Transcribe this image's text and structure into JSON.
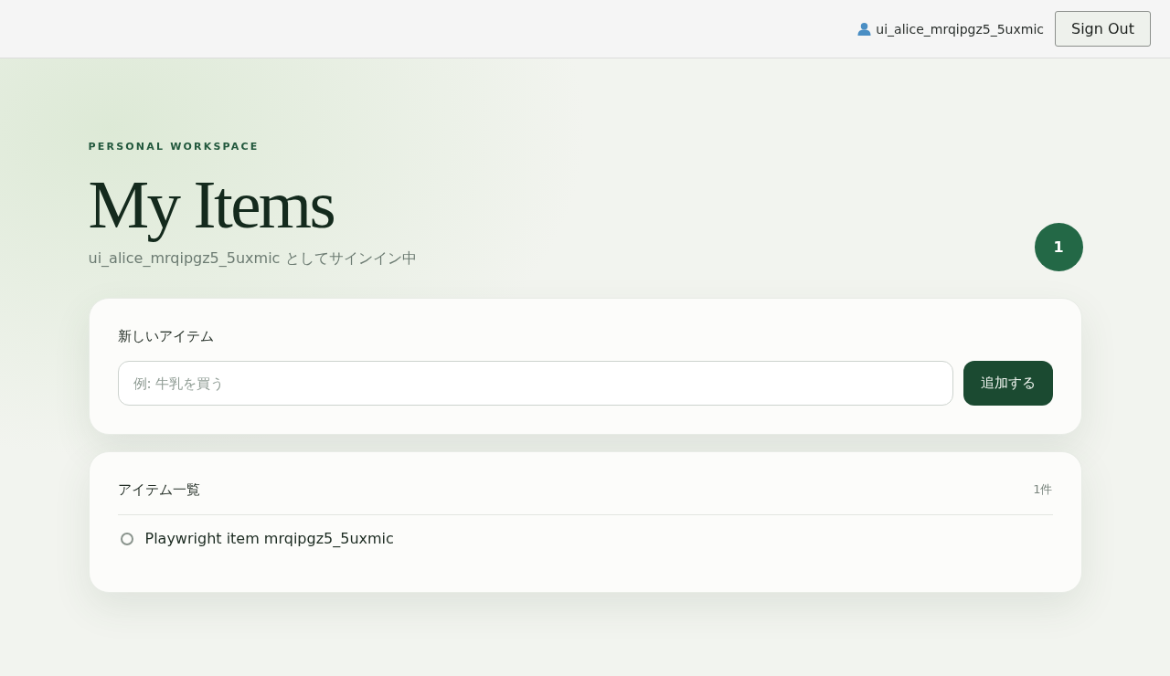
{
  "header": {
    "username": "ui_alice_mrqipgz5_5uxmic",
    "sign_out": "Sign Out"
  },
  "hero": {
    "eyebrow": "PERSONAL WORKSPACE",
    "title": "My Items",
    "subtitle": "ui_alice_mrqipgz5_5uxmic としてサインイン中",
    "count_badge": "1"
  },
  "new_item": {
    "label": "新しいアイテム",
    "placeholder": "例: 牛乳を買う",
    "button": "追加する"
  },
  "list": {
    "title": "アイテム一覧",
    "count": "1件",
    "items": [
      {
        "text": "Playwright item mrqipgz5_5uxmic",
        "done": false
      }
    ]
  }
}
